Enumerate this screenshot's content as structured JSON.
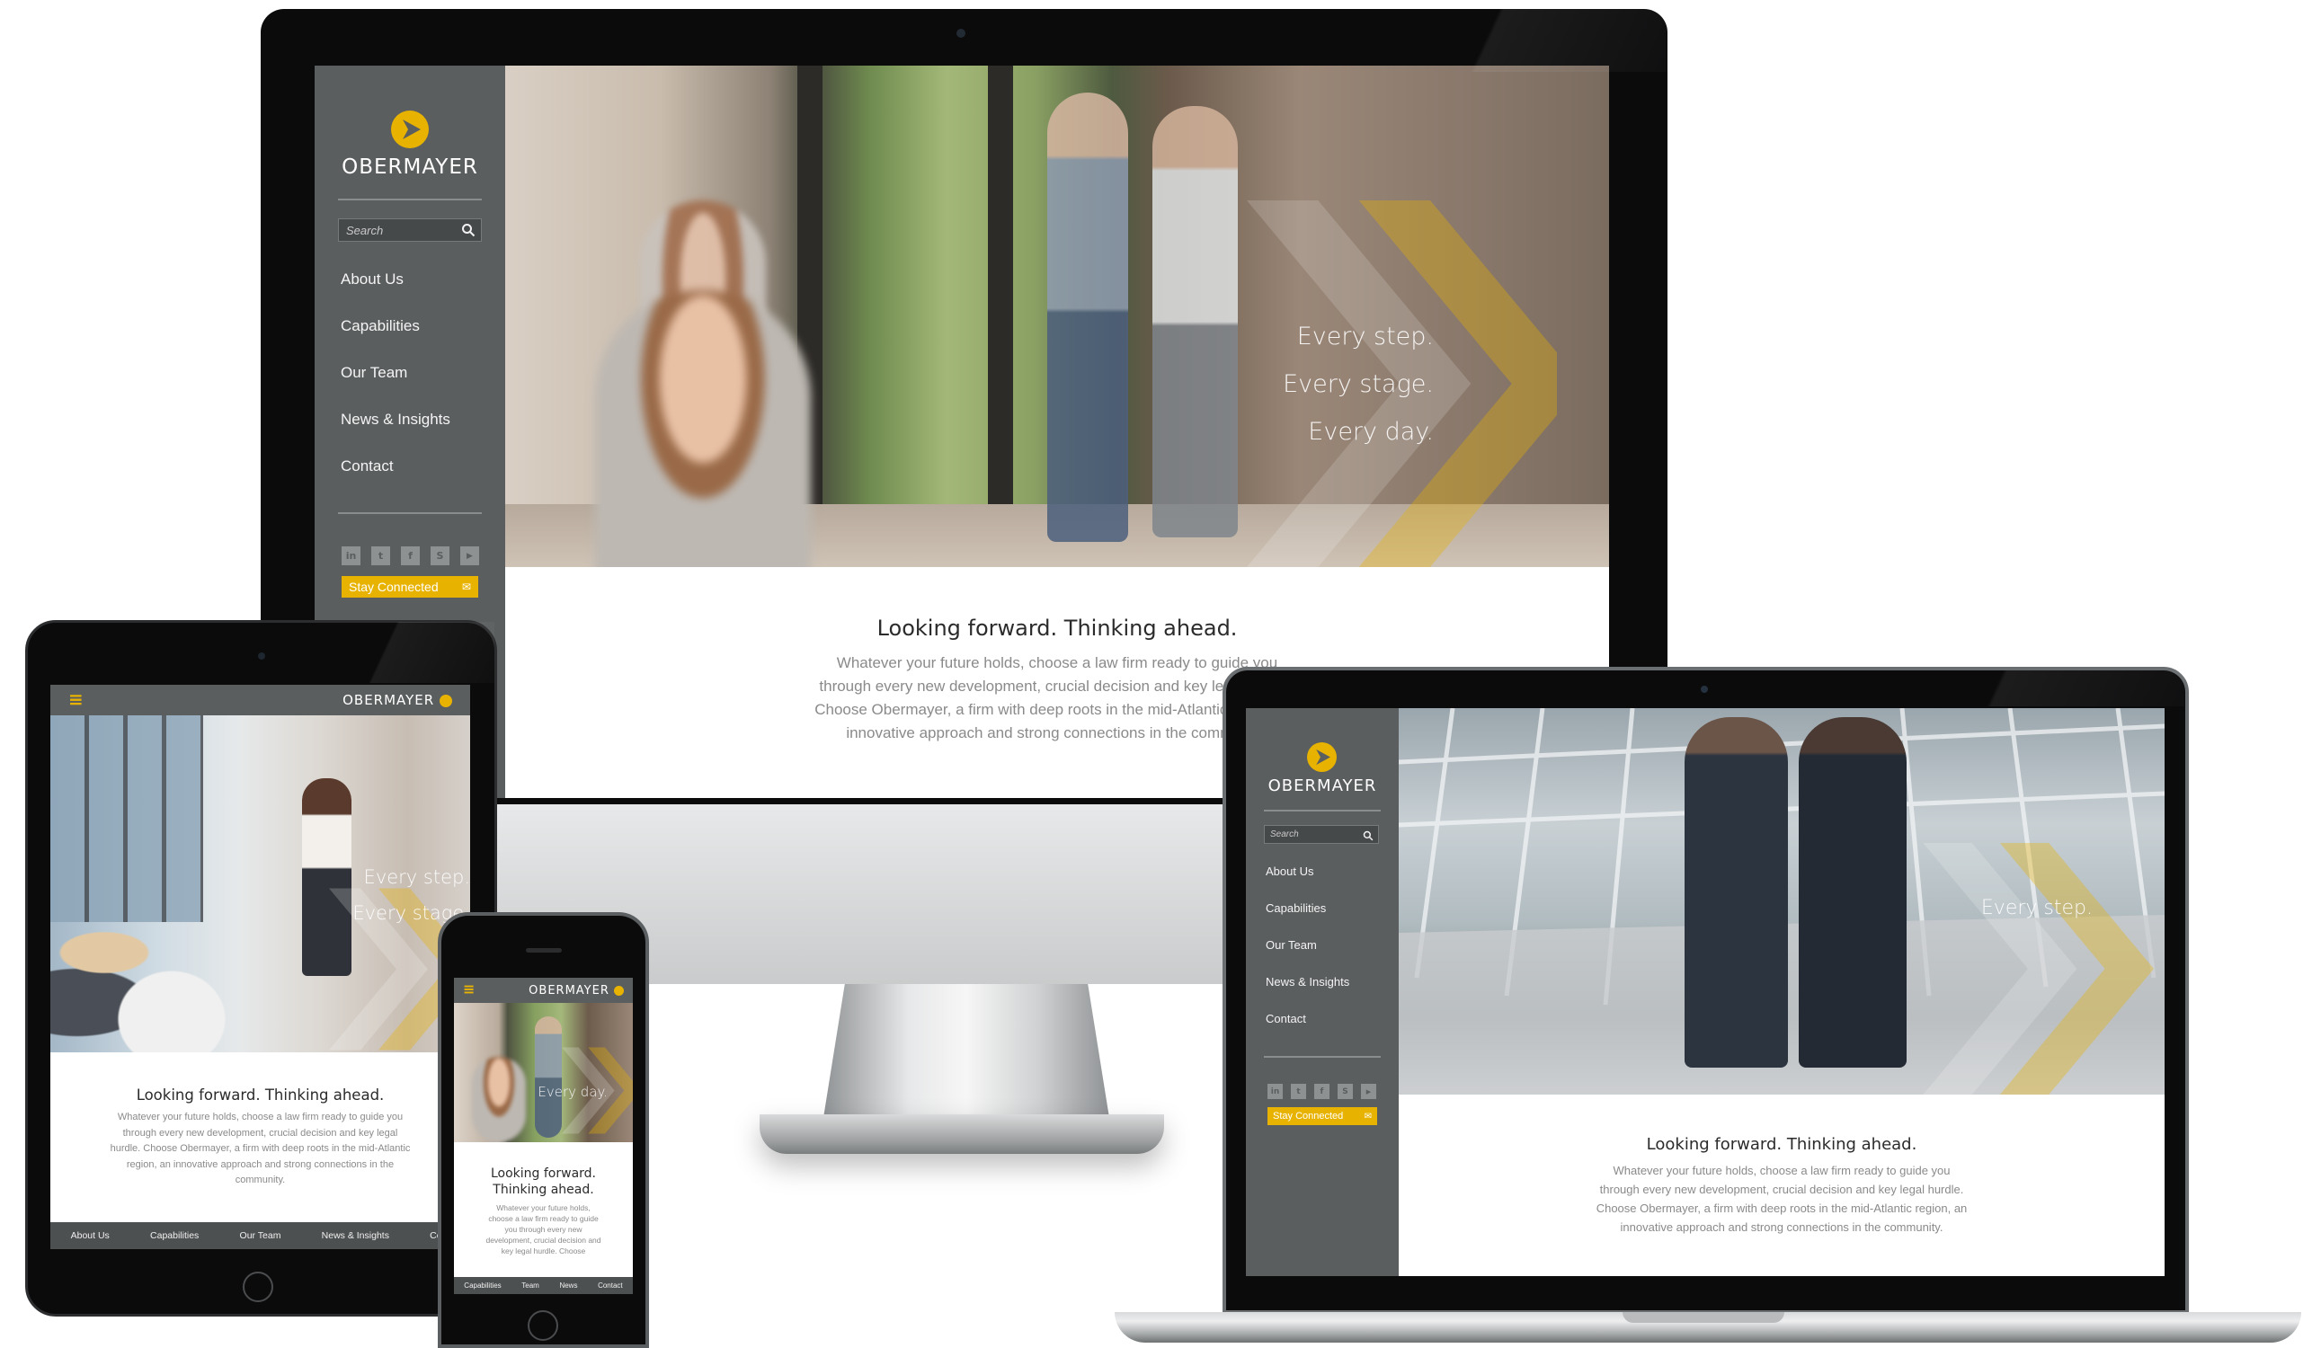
{
  "site": {
    "brand": "OBERMAYER",
    "search_placeholder": "Search",
    "nav": [
      "About Us",
      "Capabilities",
      "Our Team",
      "News & Insights",
      "Contact"
    ],
    "socials": [
      "in",
      "t",
      "f",
      "S",
      "▶"
    ],
    "stay_connected": "Stay Connected",
    "mail_glyph": "✉",
    "hamburger_glyph": "≡",
    "tagline": [
      "Every step.",
      "Every stage.",
      "Every day."
    ],
    "headline": "Looking forward. Thinking ahead.",
    "headline_phone_line1": "Looking forward.",
    "headline_phone_line2": "Thinking ahead.",
    "body": "Whatever your future holds, choose a law firm ready to guide you through every new development, crucial decision and key legal hurdle. Choose Obermayer, a firm with deep roots in the mid-Atlantic region, an innovative approach and strong connections in the community."
  },
  "desktop": {
    "tagline": [
      "Every step.",
      "Every stage.",
      "Every day."
    ],
    "body_lines": [
      "Whatever your future holds, choose a law firm ready to guide you",
      "through every new development, crucial decision and key legal hurdle.",
      "Choose Obermayer, a firm with deep roots in the mid-Atlantic region, an",
      "innovative approach and strong connections in the community."
    ]
  },
  "laptop": {
    "tagline": [
      "Every step."
    ],
    "body_lines": [
      "Whatever your future holds, choose a law firm ready to guide you",
      "through every new development, crucial decision and key legal hurdle.",
      "Choose Obermayer, a firm with deep roots in the mid-Atlantic region, an",
      "innovative approach and strong connections in the community."
    ]
  },
  "tablet": {
    "tagline": [
      "Every step.",
      "Every stage."
    ],
    "body_lines": [
      "Whatever your future holds, choose a law firm ready to guide you",
      "through every new development, crucial decision and key legal",
      "hurdle. Choose Obermayer, a firm with deep roots in the mid-Atlantic",
      "region, an innovative approach and strong connections in the",
      "community."
    ],
    "bottom_nav": [
      "About Us",
      "Capabilities",
      "Our Team",
      "News & Insights",
      "Cont"
    ]
  },
  "phone": {
    "tagline": [
      "Every day."
    ],
    "body_lines": [
      "Whatever your future holds,",
      "choose a law firm ready to guide",
      "you through every new",
      "development, crucial decision and",
      "key legal hurdle. Choose"
    ],
    "bottom_nav": [
      "Capabilities",
      "Team",
      "News",
      "Contact"
    ]
  },
  "colors": {
    "accent": "#e8b300",
    "sidebar": "#5b5e5f",
    "bezel": "#0b0b0c"
  }
}
